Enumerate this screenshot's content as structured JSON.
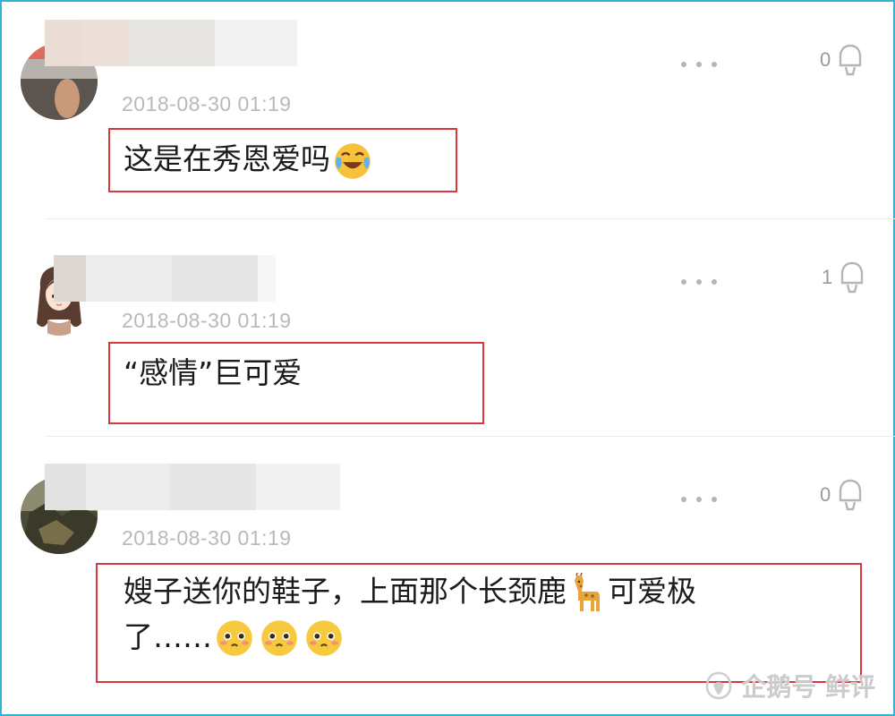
{
  "comments": [
    {
      "timestamp": "2018-08-30 01:19",
      "text": "这是在秀恩爱吗",
      "likes": "0",
      "emojis": [
        "face-with-tears-of-joy-icon"
      ]
    },
    {
      "timestamp": "2018-08-30 01:19",
      "text": "“感情”巨可爱",
      "likes": "1",
      "emojis": []
    },
    {
      "timestamp": "2018-08-30 01:19",
      "text_line1": "嫂子送你的鞋子，上面那个长颈鹿",
      "text_line1_tail": "可爱极",
      "text_line2": "了……",
      "likes": "0",
      "emojis": [
        "giraffe-icon",
        "pleading-face-icon",
        "pleading-face-icon",
        "pleading-face-icon"
      ]
    }
  ],
  "watermark": {
    "text": "企鹅号 鲜评"
  },
  "colors": {
    "frame": "#33b3d4",
    "highlight": "#d9363e",
    "timestamp": "#b9b9b9",
    "icon_gray": "#b5b5b5"
  }
}
